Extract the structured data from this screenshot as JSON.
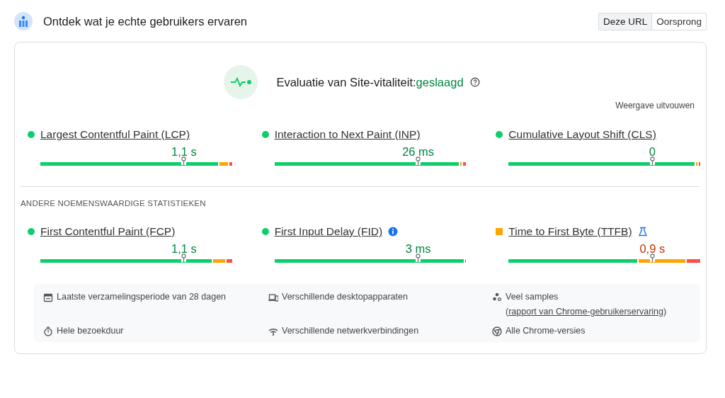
{
  "header": {
    "title": "Ontdek wat je echte gebruikers ervaren",
    "toggle": [
      {
        "label": "Deze URL",
        "selected": true
      },
      {
        "label": "Oorsprong",
        "selected": false
      }
    ]
  },
  "assessment": {
    "label": "Evaluatie van Site-vitaliteit:",
    "result": "geslaagd",
    "passed": true,
    "expand": "Weergave uitvouwen"
  },
  "core_metrics": [
    {
      "name": "Largest Contentful Paint (LCP)",
      "color": "#0cce6b",
      "value": "1,1 s"
    },
    {
      "name": "Interaction to Next Paint (INP)",
      "color": "#0cce6b",
      "value": "26 ms"
    },
    {
      "name": "Cumulative Layout Shift (CLS)",
      "color": "#0cce6b",
      "value": "0"
    }
  ],
  "other_heading": "ANDERE NOEMENSWAARDIGE STATISTIEKEN",
  "other_metrics": [
    {
      "name": "First Contentful Paint (FCP)",
      "color": "#0cce6b",
      "value": "1,1 s"
    },
    {
      "name": "First Input Delay (FID)",
      "color": "#0cce6b",
      "value": "3 ms",
      "kind": "info"
    },
    {
      "name": "Time to First Byte (TTFB)",
      "color": "#ffa400",
      "value": "0,9 s",
      "kind": "experimental"
    }
  ],
  "footer": [
    {
      "kind": "calendar",
      "text": "Laatste verzamelingsperiode van 28 dagen"
    },
    {
      "kind": "devices",
      "text": "Verschillende desktopapparaten"
    },
    {
      "kind": "samples",
      "text": "Veel samples (",
      "link": "rapport van Chrome-gebruikerservaring",
      "after": ")"
    },
    {
      "kind": "timer",
      "text": "Hele bezoekduur"
    },
    {
      "kind": "network",
      "text": "Verschillende netwerkverbindingen"
    },
    {
      "kind": "chrome",
      "text": "Alle Chrome-versies"
    }
  ]
}
